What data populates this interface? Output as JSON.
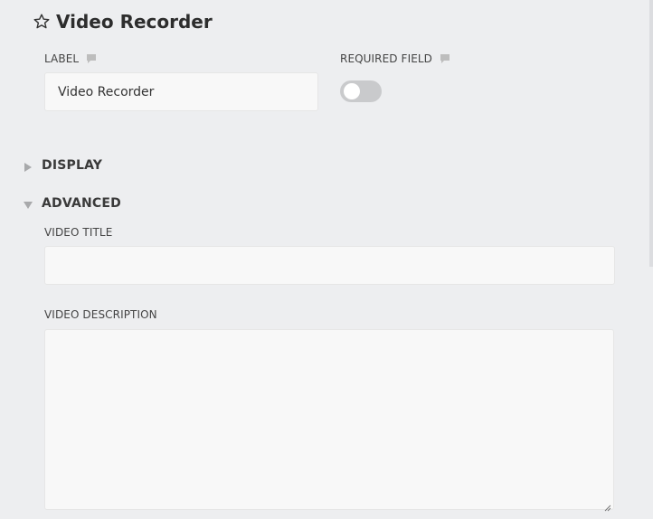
{
  "header": {
    "title": "Video Recorder",
    "icon": "star-outline-icon"
  },
  "label_field": {
    "label": "LABEL",
    "value": "Video Recorder"
  },
  "required_field": {
    "label": "REQUIRED FIELD",
    "enabled": false
  },
  "sections": {
    "display": {
      "label": "DISPLAY",
      "expanded": false
    },
    "advanced": {
      "label": "ADVANCED",
      "expanded": true
    }
  },
  "advanced": {
    "video_title_label": "VIDEO TITLE",
    "video_title_value": "",
    "video_description_label": "VIDEO DESCRIPTION",
    "video_description_value": ""
  },
  "colors": {
    "background": "#edeef0",
    "input_background": "#f8f8f8",
    "toggle_off": "#c9cacc"
  }
}
